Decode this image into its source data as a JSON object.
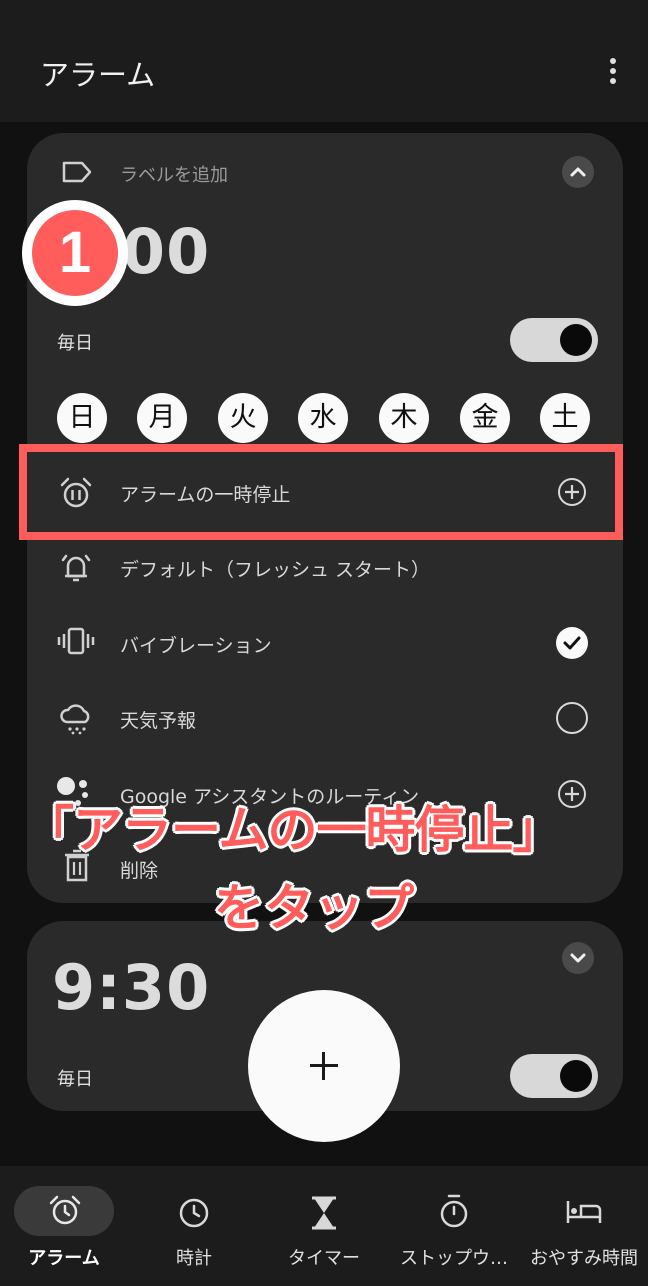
{
  "app": {
    "title": "アラーム"
  },
  "alarm1": {
    "label_placeholder": "ラベルを追加",
    "time": "1:00",
    "repeat": "毎日",
    "enabled": true,
    "days": [
      "日",
      "月",
      "火",
      "水",
      "木",
      "金",
      "土"
    ],
    "options": {
      "pause": "アラームの一時停止",
      "sound": "デフォルト（フレッシュ スタート）",
      "vibration": "バイブレーション",
      "weather": "天気予報",
      "assistant": "Google アシスタントのルーティン",
      "delete": "削除"
    }
  },
  "alarm2": {
    "time": "9:30",
    "repeat": "毎日",
    "enabled": true
  },
  "fab": {
    "label": "+"
  },
  "annotation": {
    "step": "1",
    "line1": "「アラームの一時停止」",
    "line2": "をタップ",
    "color": "#ff5c5c"
  },
  "nav": {
    "items": [
      {
        "label": "アラーム",
        "icon": "alarm-clock-icon",
        "active": true
      },
      {
        "label": "時計",
        "icon": "clock-icon"
      },
      {
        "label": "タイマー",
        "icon": "hourglass-icon"
      },
      {
        "label": "ストップウ…",
        "icon": "stopwatch-icon"
      },
      {
        "label": "おやすみ時間",
        "icon": "bed-icon"
      }
    ]
  }
}
